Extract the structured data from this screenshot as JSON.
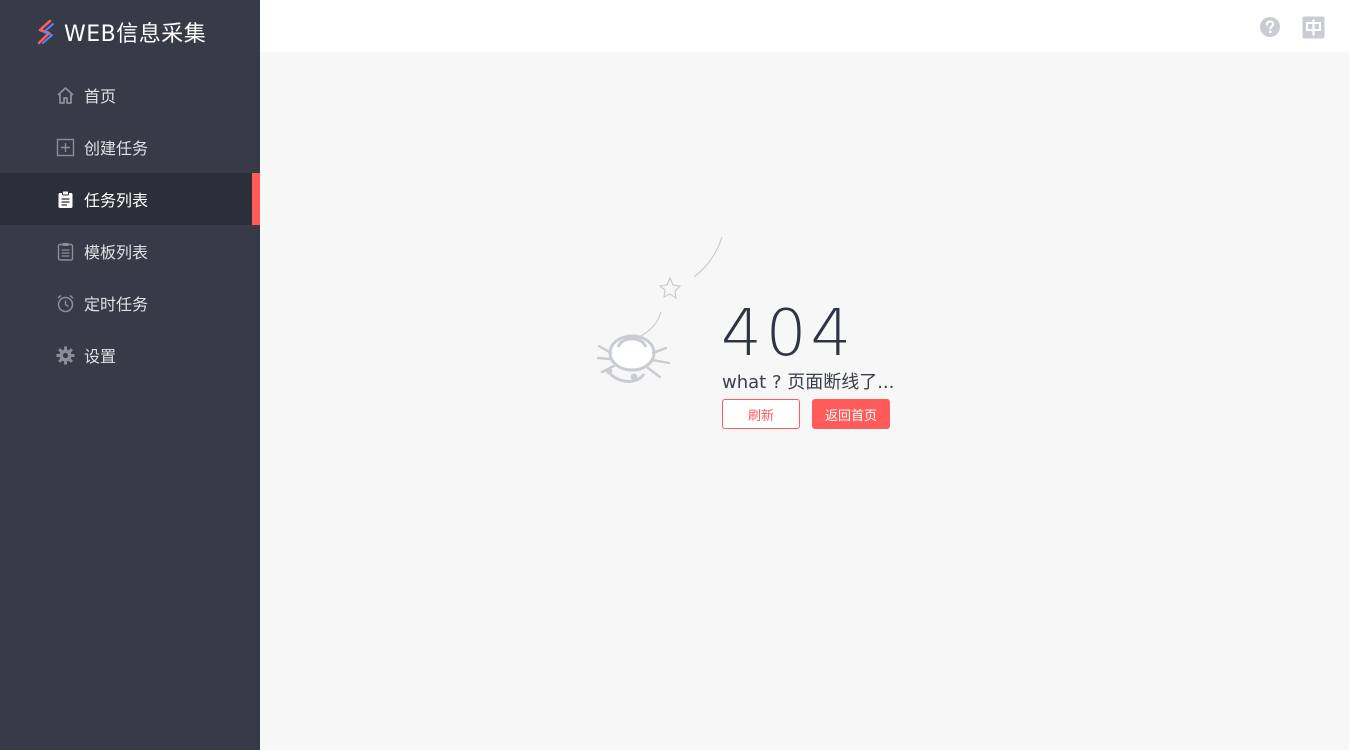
{
  "app": {
    "title": "WEB信息采集"
  },
  "sidebar": {
    "items": [
      {
        "label": "首页",
        "icon": "home-icon",
        "active": false
      },
      {
        "label": "创建任务",
        "icon": "plus-square-icon",
        "active": false
      },
      {
        "label": "任务列表",
        "icon": "clipboard-icon",
        "active": true
      },
      {
        "label": "模板列表",
        "icon": "list-icon",
        "active": false
      },
      {
        "label": "定时任务",
        "icon": "alarm-clock-icon",
        "active": false
      },
      {
        "label": "设置",
        "icon": "gear-icon",
        "active": false
      }
    ]
  },
  "header": {
    "help_icon": "question-circle-icon",
    "lang_icon": "chinese-language-icon"
  },
  "error": {
    "code": "404",
    "message": "what ? 页面断线了...",
    "refresh_label": "刷新",
    "home_label": "返回首页"
  },
  "colors": {
    "sidebar_bg": "#373a47",
    "accent": "#ff5b5b",
    "content_bg": "#f7f7f7"
  }
}
